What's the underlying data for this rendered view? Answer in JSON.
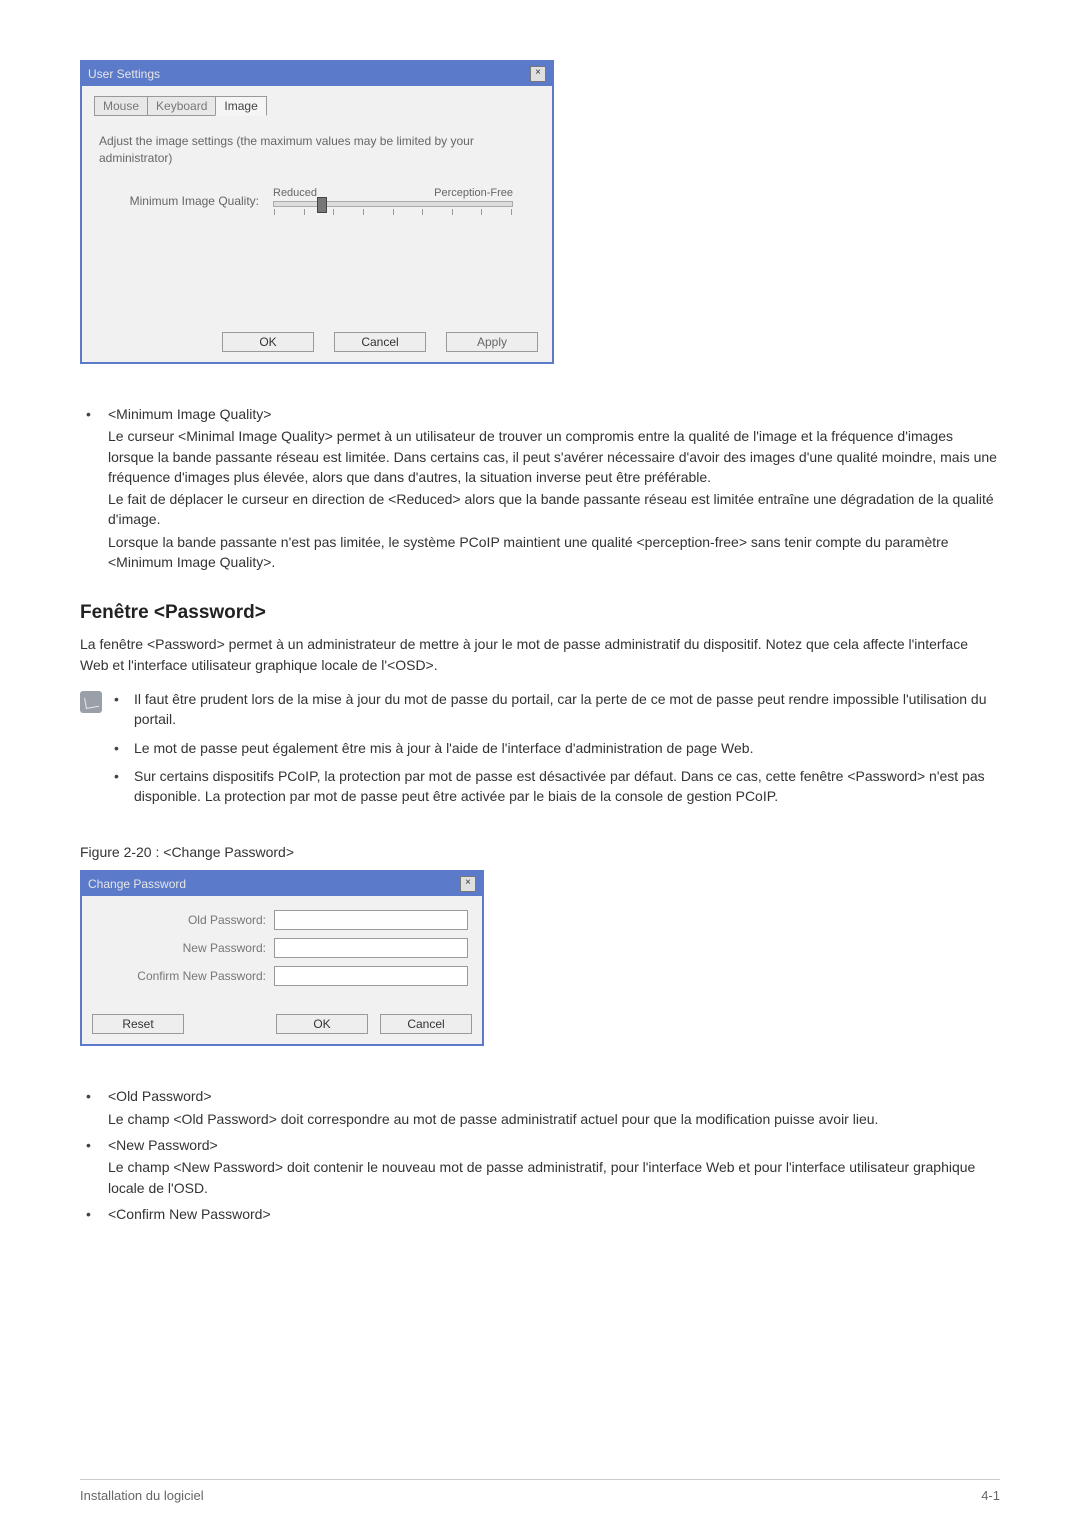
{
  "user_settings_dialog": {
    "title": "User Settings",
    "tabs": {
      "mouse": "Mouse",
      "keyboard": "Keyboard",
      "image": "Image"
    },
    "description": "Adjust the image settings (the maximum values may be limited by your administrator)",
    "slider_label": "Minimum Image Quality:",
    "slider_left": "Reduced",
    "slider_right": "Perception-Free",
    "buttons": {
      "ok": "OK",
      "cancel": "Cancel",
      "apply": "Apply"
    }
  },
  "min_quality_section": {
    "heading": "<Minimum Image Quality>",
    "p1": "Le curseur <Minimal Image Quality> permet à un utilisateur de trouver un compromis entre la qualité de l'image et la fréquence d'images lorsque la bande passante réseau est limitée. Dans certains cas, il peut s'avérer nécessaire d'avoir des images d'une qualité moindre, mais une fréquence d'images plus élevée, alors que dans d'autres, la situation inverse peut être préférable.",
    "p2": "Le fait de déplacer le curseur en direction de <Reduced> alors que la bande passante réseau est limitée entraîne une dégradation de la qualité d'image.",
    "p3": "Lorsque la bande passante n'est pas limitée, le système PCoIP maintient une qualité <perception-free> sans tenir compte du paramètre <Minimum Image Quality>."
  },
  "password_section": {
    "heading": "Fenêtre <Password>",
    "lead": "La fenêtre <Password> permet à un administrateur de mettre à jour le mot de passe administratif du dispositif. Notez que cela affecte l'interface Web et l'interface utilisateur graphique locale de l'<OSD>.",
    "notes": [
      "Il faut être prudent lors de la mise à jour du mot de passe du portail, car la perte de ce mot de passe peut rendre impossible l'utilisation du portail.",
      "Le mot de passe peut également être mis à jour à l'aide de l'interface d'administration de page Web.",
      "Sur certains dispositifs PCoIP, la protection par mot de passe est désactivée par défaut. Dans ce cas, cette fenêtre <Password> n'est pas disponible. La protection par mot de passe peut être activée par le biais de la console de gestion PCoIP."
    ],
    "figure_caption": "Figure 2-20 : <Change Password>"
  },
  "change_password_dialog": {
    "title": "Change Password",
    "labels": {
      "old": "Old Password:",
      "new": "New Password:",
      "confirm": "Confirm New Password:"
    },
    "buttons": {
      "reset": "Reset",
      "ok": "OK",
      "cancel": "Cancel"
    }
  },
  "password_fields_section": {
    "items": [
      {
        "head": "<Old Password>",
        "body": "Le champ <Old Password> doit correspondre au mot de passe administratif actuel pour que la modification puisse avoir lieu."
      },
      {
        "head": "<New Password>",
        "body": "Le champ <New Password> doit contenir le nouveau mot de passe administratif, pour l'interface Web et pour l'interface utilisateur graphique locale de l'OSD."
      },
      {
        "head": "<Confirm New Password>",
        "body": ""
      }
    ]
  },
  "footer": {
    "left": "Installation du logiciel",
    "right": "4-1"
  }
}
